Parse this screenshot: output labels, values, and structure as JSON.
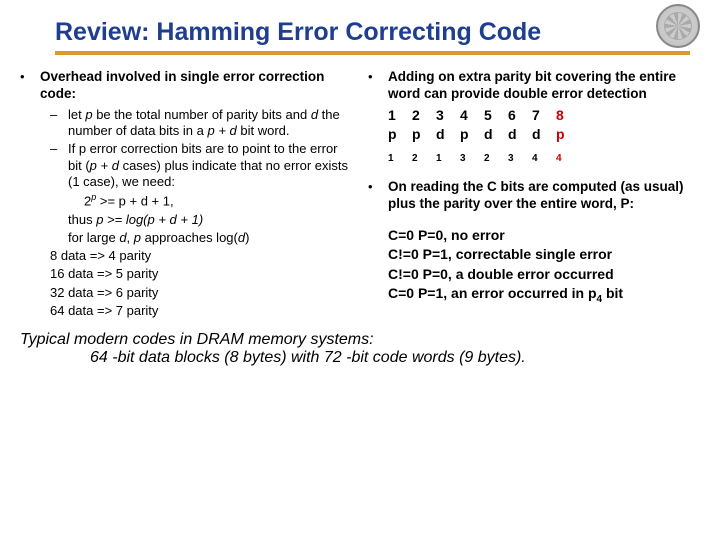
{
  "title": "Review: Hamming Error Correcting Code",
  "left": {
    "heading": "Overhead involved in single error correction code:",
    "sub1_a": "let ",
    "sub1_p": "p",
    "sub1_b": " be the total number of parity bits and ",
    "sub1_d": "d",
    "sub1_c": " the number of data bits in a ",
    "sub1_pd": "p + d",
    "sub1_e": " bit word.",
    "sub2_a": "If p error correction bits are to point to the error bit (",
    "sub2_pd": "p + d",
    "sub2_b": " cases) plus indicate that no error exists (1 case), we need:",
    "formula1_a": "2",
    "formula1_sup": "p",
    "formula1_b": " >= p + d + 1,",
    "formula2_a": "thus ",
    "formula2_b": "p >= log(p + d + 1)",
    "formula3_a": "for large ",
    "formula3_d": "d",
    "formula3_b": ", ",
    "formula3_p": "p",
    "formula3_c": " approaches log(",
    "formula3_d2": "d",
    "formula3_e": ")",
    "map1": "8 data => 4 parity",
    "map2": "16 data => 5 parity",
    "map3": "32 data => 6 parity",
    "map4": "64 data => 7 parity"
  },
  "right": {
    "heading": "Adding on extra parity bit covering the entire word can provide double error detection",
    "nums": [
      "1",
      "2",
      "3",
      "4",
      "5",
      "6",
      "7",
      "8"
    ],
    "syms_plain": [
      "p",
      "p",
      "d",
      "p",
      "d",
      "d",
      "d"
    ],
    "syms_subs": [
      "1",
      "2",
      "1",
      "3",
      "2",
      "3",
      "4"
    ],
    "sym_red": "p",
    "sym_red_sub": "4",
    "bullet2": "On reading the C bits are computed (as usual) plus the parity over the entire word, P:",
    "case1": "C=0  P=0, no error",
    "case2": "C!=0 P=1, correctable single error",
    "case3": "C!=0 P=0, a double error occurred",
    "case4_a": "C=0  P=1, an error occurred in p",
    "case4_sub": "4",
    "case4_b": " bit"
  },
  "footer": {
    "line1": "Typical modern codes in DRAM memory systems:",
    "line2": "64 -bit data blocks (8 bytes) with 72 -bit code words (9 bytes)."
  },
  "chart_data": {
    "type": "table",
    "title": "Data bits to parity bits mapping",
    "columns": [
      "data_bits",
      "parity_bits"
    ],
    "rows": [
      [
        8,
        4
      ],
      [
        16,
        5
      ],
      [
        32,
        6
      ],
      [
        64,
        7
      ]
    ]
  }
}
